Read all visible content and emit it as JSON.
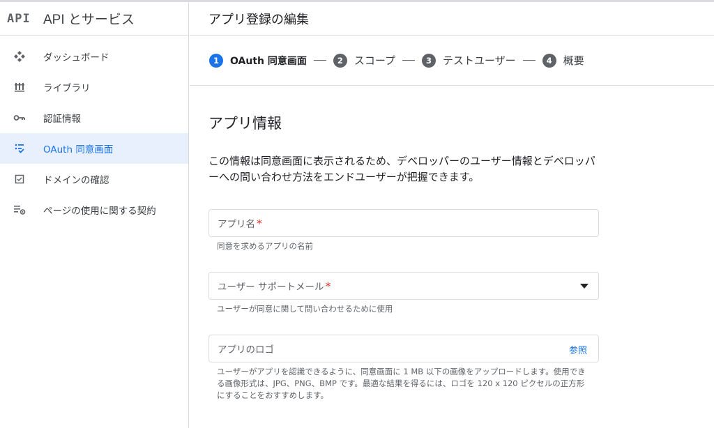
{
  "brand": {
    "logo": "API",
    "title": "API とサービス"
  },
  "sidebar": {
    "items": [
      {
        "label": "ダッシュボード",
        "icon": "dashboard-icon"
      },
      {
        "label": "ライブラリ",
        "icon": "library-icon"
      },
      {
        "label": "認証情報",
        "icon": "key-icon"
      },
      {
        "label": "OAuth 同意画面",
        "icon": "consent-screen-icon",
        "active": true
      },
      {
        "label": "ドメインの確認",
        "icon": "checkbox-icon"
      },
      {
        "label": "ページの使用に関する契約",
        "icon": "page-settings-icon"
      }
    ]
  },
  "header": {
    "title": "アプリ登録の編集"
  },
  "stepper": {
    "steps": [
      {
        "num": "1",
        "label": "OAuth 同意画面",
        "active": true
      },
      {
        "num": "2",
        "label": "スコープ"
      },
      {
        "num": "3",
        "label": "テストユーザー"
      },
      {
        "num": "4",
        "label": "概要"
      }
    ]
  },
  "form": {
    "section_title": "アプリ情報",
    "description": "この情報は同意画面に表示されるため、デベロッパーのユーザー情報とデベロッパーへの問い合わせ方法をエンドユーザーが把握できます。",
    "app_name": {
      "placeholder": "アプリ名",
      "required": "*",
      "hint": "同意を求めるアプリの名前"
    },
    "support_email": {
      "placeholder": "ユーザー サポートメール",
      "required": "*",
      "hint": "ユーザーが同意に関して問い合わせるために使用"
    },
    "logo": {
      "placeholder": "アプリのロゴ",
      "browse": "参照",
      "hint": "ユーザーがアプリを認識できるように、同意画面に 1 MB 以下の画像をアップロードします。使用できる画像形式は、JPG、PNG、BMP です。最適な結果を得るには、ロゴを 120 x 120 ピクセルの正方形にすることをおすすめします。"
    }
  },
  "colors": {
    "accent": "#1a73e8",
    "active_bg": "#e8f0fe",
    "required": "#d93025",
    "border": "#dadce0"
  }
}
